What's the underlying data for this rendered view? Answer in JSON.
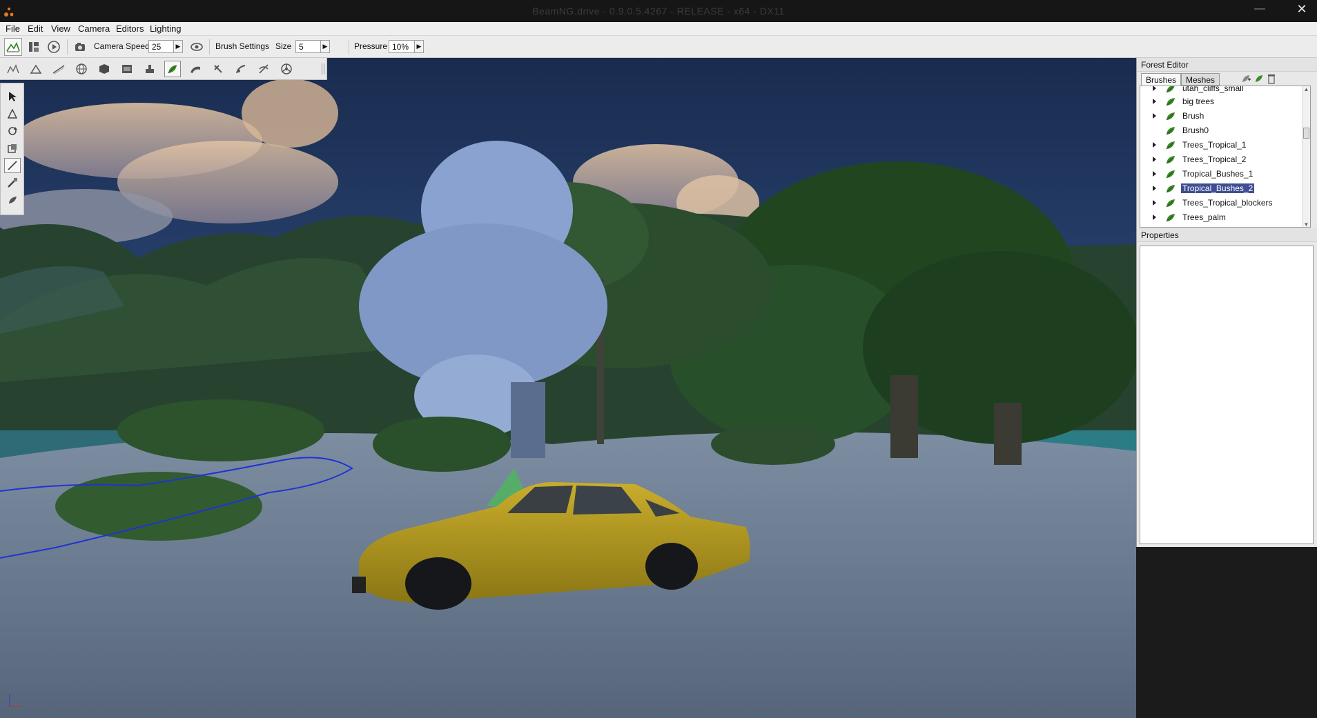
{
  "window": {
    "title": "BeamNG.drive - 0.9.0.5.4267 - RELEASE - x64 - DX11",
    "close_glyph": "✕",
    "minimize_glyph": "—",
    "maximize_glyph": "☐"
  },
  "menu": [
    "File",
    "Edit",
    "View",
    "Camera",
    "Editors",
    "Lighting"
  ],
  "toolbar": {
    "camera_speed_label": "Camera Speed",
    "camera_speed_value": "25",
    "brush_settings_label": "Brush Settings",
    "size_label": "Size",
    "size_value": "5",
    "pressure_label": "Pressure",
    "pressure_value": "10%"
  },
  "forest_editor": {
    "title": "Forest Editor",
    "tabs": [
      {
        "label": "Brushes",
        "active": true
      },
      {
        "label": "Meshes",
        "active": false
      }
    ],
    "items": [
      {
        "label": "utah_cliffs_small",
        "expandable": true,
        "selected": false
      },
      {
        "label": "big trees",
        "expandable": true,
        "selected": false
      },
      {
        "label": "Brush",
        "expandable": true,
        "selected": false
      },
      {
        "label": "Brush0",
        "expandable": false,
        "selected": false
      },
      {
        "label": "Trees_Tropical_1",
        "expandable": true,
        "selected": false
      },
      {
        "label": "Trees_Tropical_2",
        "expandable": true,
        "selected": false
      },
      {
        "label": "Tropical_Bushes_1",
        "expandable": true,
        "selected": false
      },
      {
        "label": "Tropical_Bushes_2",
        "expandable": true,
        "selected": true
      },
      {
        "label": "Trees_Tropical_blockers",
        "expandable": true,
        "selected": false
      },
      {
        "label": "Trees_palm",
        "expandable": true,
        "selected": false
      }
    ]
  },
  "properties": {
    "title": "Properties"
  },
  "colors": {
    "selection": "#3f4e93",
    "leaf_icon": "#3c8a2a",
    "sky": "#22365e",
    "sand": "#5f6f83"
  }
}
